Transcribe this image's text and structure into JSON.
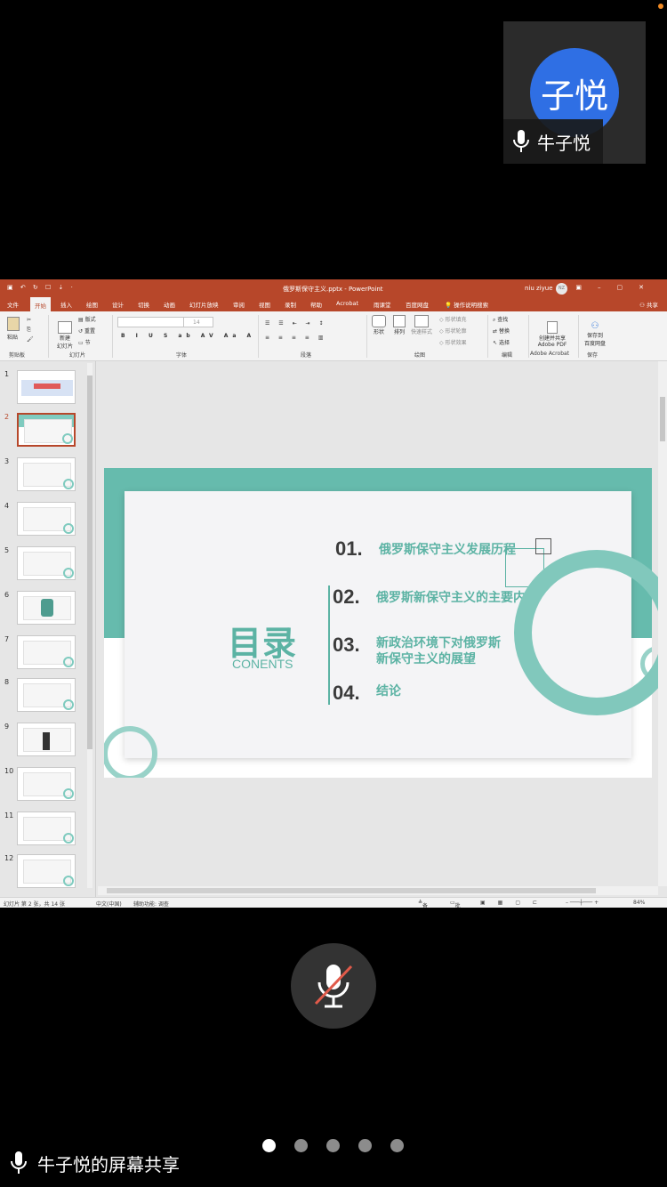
{
  "participant": {
    "avatar_text": "子悦",
    "name": "牛子悦"
  },
  "app": {
    "doc_title": "俄罗斯保守主义.pptx - PowerPoint",
    "user": "niu ziyue",
    "user_initials": "NZ",
    "tabs": [
      "文件",
      "开始",
      "插入",
      "绘图",
      "设计",
      "切换",
      "动画",
      "幻灯片放映",
      "审阅",
      "视图",
      "录制",
      "帮助",
      "Acrobat",
      "雨课堂",
      "百度网盘"
    ],
    "active_tab": "开始",
    "tell_me": "操作说明搜索",
    "share": "共享"
  },
  "ribbon": {
    "paste": "粘贴",
    "new_slide": "新建\n幻灯片",
    "layout": "版式",
    "reset": "重置",
    "section": "节",
    "shape": "形状",
    "arrange": "排列",
    "quick_styles": "快速样式",
    "shape_fill": "形状填充",
    "shape_outline": "形状轮廓",
    "shape_effects": "形状效果",
    "find": "查找",
    "replace": "替换",
    "select": "选择",
    "adobe_create": "创建并共享\nAdobe PDF",
    "baidu_save": "保存到\n百度网盘",
    "font_size": "14",
    "groups": {
      "clipboard": "剪贴板",
      "slides": "幻灯片",
      "font": "字体",
      "paragraph": "段落",
      "drawing": "绘图",
      "editing": "编辑",
      "adobe": "Adobe Acrobat",
      "save": "保存"
    }
  },
  "thumbnails": {
    "numbers": [
      "1",
      "2",
      "3",
      "4",
      "5",
      "6",
      "7",
      "8",
      "9",
      "10",
      "11",
      "12"
    ],
    "selected": "2"
  },
  "slide": {
    "title": "目录",
    "subtitle": "CONENTS",
    "items": [
      {
        "num": "01.",
        "text": "俄罗斯保守主义发展历程"
      },
      {
        "num": "02.",
        "text": "俄罗斯新保守主义的主要内容"
      },
      {
        "num": "03.",
        "text": "新政治环境下对俄罗斯\n新保守主义的展望"
      },
      {
        "num": "04.",
        "text": "结论"
      }
    ]
  },
  "statusbar": {
    "slide_info": "幻灯片 第 2 张，共 14 张",
    "language": "中文(中国)",
    "accessibility": "辅助功能: 调查",
    "notes": "备注",
    "comments": "批注",
    "zoom": "84%"
  },
  "footer": {
    "share_label": "牛子悦的屏幕共享"
  },
  "page_dots": {
    "count": 5,
    "active_index": 1
  }
}
